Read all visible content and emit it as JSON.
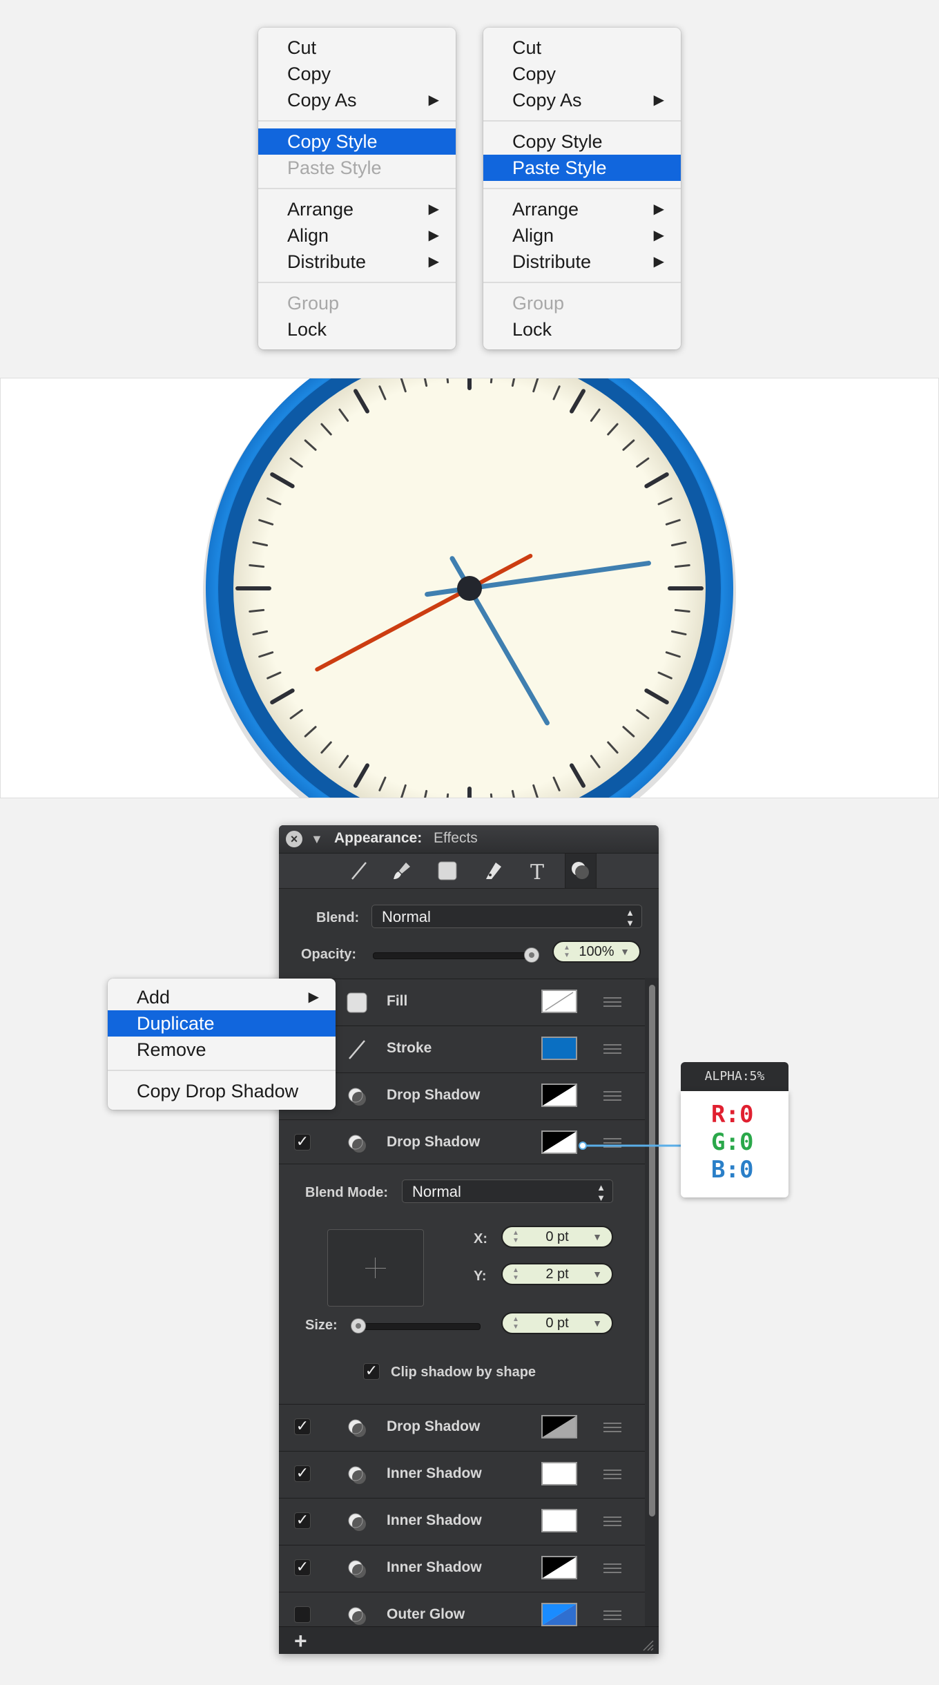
{
  "menu_left": {
    "items": [
      {
        "label": "Cut",
        "state": "normal"
      },
      {
        "label": "Copy",
        "state": "normal"
      },
      {
        "label": "Copy As",
        "state": "normal",
        "submenu": true
      },
      {
        "label": "Copy Style",
        "state": "highlighted"
      },
      {
        "label": "Paste Style",
        "state": "disabled"
      },
      {
        "label": "Arrange",
        "state": "normal",
        "submenu": true
      },
      {
        "label": "Align",
        "state": "normal",
        "submenu": true
      },
      {
        "label": "Distribute",
        "state": "normal",
        "submenu": true
      },
      {
        "label": "Group",
        "state": "disabled"
      },
      {
        "label": "Lock",
        "state": "normal"
      }
    ]
  },
  "menu_right": {
    "items": [
      {
        "label": "Cut",
        "state": "normal"
      },
      {
        "label": "Copy",
        "state": "normal"
      },
      {
        "label": "Copy As",
        "state": "normal",
        "submenu": true
      },
      {
        "label": "Copy Style",
        "state": "normal"
      },
      {
        "label": "Paste Style",
        "state": "highlighted"
      },
      {
        "label": "Arrange",
        "state": "normal",
        "submenu": true
      },
      {
        "label": "Align",
        "state": "normal",
        "submenu": true
      },
      {
        "label": "Distribute",
        "state": "normal",
        "submenu": true
      },
      {
        "label": "Group",
        "state": "disabled"
      },
      {
        "label": "Lock",
        "state": "normal"
      }
    ]
  },
  "clock": {
    "ring_color": "#1a7fd6",
    "face_color": "#fbf9e9",
    "hour_hand_color": "#3f7fb0",
    "second_hand_color": "#cc3d11"
  },
  "panel": {
    "title": "Appearance:",
    "subtitle": "Effects",
    "tools": [
      "line-tool-icon",
      "brush-tool-icon",
      "fill-tool-icon",
      "pen-tool-icon",
      "text-tool-icon",
      "effects-tool-icon"
    ],
    "blend_label": "Blend:",
    "blend_value": "Normal",
    "opacity_label": "Opacity:",
    "opacity_value": "100%",
    "opacity_fraction": 1.0,
    "rows_top": [
      {
        "label": "Fill",
        "checked": true,
        "icon": "fill-icon",
        "swatch": "none"
      },
      {
        "label": "Stroke",
        "checked": true,
        "icon": "stroke-icon",
        "swatch": "#0a6fc2"
      },
      {
        "label": "Drop Shadow",
        "checked": true,
        "icon": "shadow-icon",
        "swatch": "black-white"
      },
      {
        "label": "Drop Shadow",
        "checked": true,
        "icon": "shadow-icon",
        "swatch": "black-white"
      }
    ],
    "detail": {
      "blend_mode_label": "Blend Mode:",
      "blend_mode_value": "Normal",
      "x_label": "X:",
      "x_value": "0 pt",
      "y_label": "Y:",
      "y_value": "2 pt",
      "size_label": "Size:",
      "size_value": "0 pt",
      "size_fraction": 0.0,
      "clip_label": "Clip shadow by shape",
      "clip_checked": true
    },
    "rows_bottom": [
      {
        "label": "Drop Shadow",
        "checked": true,
        "icon": "shadow-icon",
        "swatch": "black-gray"
      },
      {
        "label": "Inner Shadow",
        "checked": true,
        "icon": "shadow-icon",
        "swatch": "white"
      },
      {
        "label": "Inner Shadow",
        "checked": true,
        "icon": "shadow-icon",
        "swatch": "white"
      },
      {
        "label": "Inner Shadow",
        "checked": true,
        "icon": "shadow-icon",
        "swatch": "black-white"
      },
      {
        "label": "Outer Glow",
        "checked": false,
        "icon": "shadow-icon",
        "swatch": "blue"
      }
    ],
    "add_label": "+"
  },
  "context_menu": {
    "items": [
      {
        "label": "Add",
        "state": "normal",
        "submenu": true
      },
      {
        "label": "Duplicate",
        "state": "highlighted"
      },
      {
        "label": "Remove",
        "state": "normal"
      },
      {
        "label": "Copy Drop Shadow",
        "state": "normal"
      }
    ]
  },
  "alpha_callout": {
    "header": "ALPHA:5%",
    "r": "R:0",
    "g": "G:0",
    "b": "B:0",
    "r_color": "#e02030",
    "g_color": "#2aa84a",
    "b_color": "#2a7fc8"
  }
}
